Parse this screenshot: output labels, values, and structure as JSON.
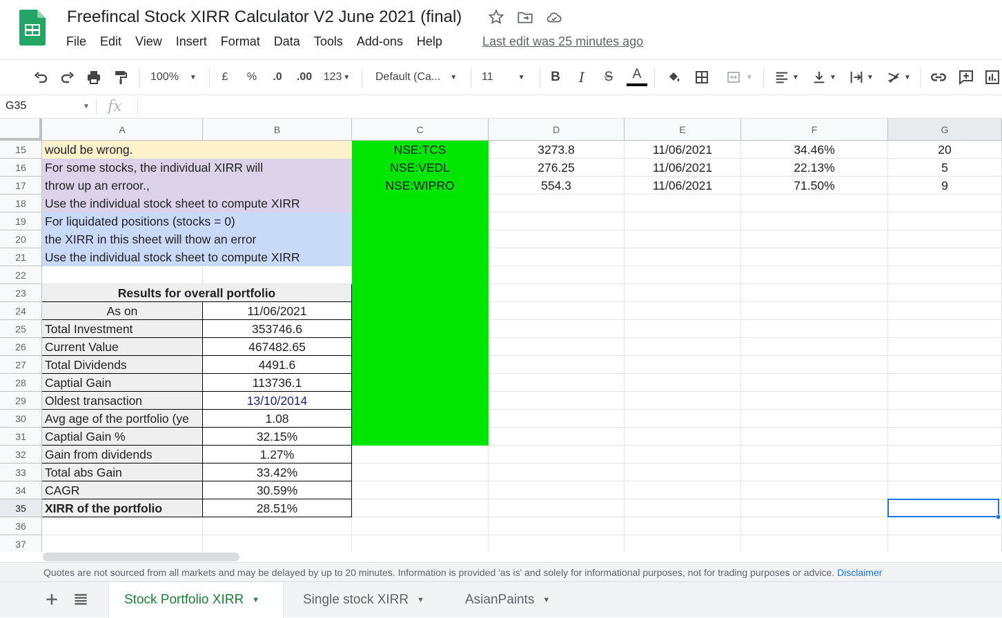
{
  "app": {
    "title": "Freefincal Stock XIRR Calculator V2 June 2021 (final)",
    "menus": [
      "File",
      "Edit",
      "View",
      "Insert",
      "Format",
      "Data",
      "Tools",
      "Add-ons",
      "Help"
    ],
    "last_edit": "Last edit was 25 minutes ago"
  },
  "toolbar": {
    "zoom": "100%",
    "currency": "£",
    "percent": "%",
    "decrease_decimal": ".0",
    "increase_decimal": ".00",
    "more_formats": "123",
    "font": "Default (Ca...",
    "font_size": "11",
    "bold": "B",
    "italic": "I",
    "strike": "S",
    "text_color": "A"
  },
  "formula_bar": {
    "cell_ref": "G35",
    "fx": "fx",
    "formula": ""
  },
  "columns": [
    "A",
    "B",
    "C",
    "D",
    "E",
    "F",
    "G"
  ],
  "rows": [
    {
      "n": "15",
      "a": "would be wrong.",
      "b": "",
      "c": "NSE:TCS",
      "d": "3273.8",
      "e": "11/06/2021",
      "f": "34.46%",
      "g": "20"
    },
    {
      "n": "16",
      "a": "For some stocks, the individual XIRR will",
      "b": "",
      "c": "NSE:VEDL",
      "d": "276.25",
      "e": "11/06/2021",
      "f": "22.13%",
      "g": "5"
    },
    {
      "n": "17",
      "a": "throw up an erroor.,",
      "b": "",
      "c": "NSE:WIPRO",
      "d": "554.3",
      "e": "11/06/2021",
      "f": "71.50%",
      "g": "9"
    },
    {
      "n": "18",
      "a": "Use the individual stock sheet to compute XIRR",
      "b": "",
      "c": "",
      "d": "",
      "e": "",
      "f": "",
      "g": ""
    },
    {
      "n": "19",
      "a": "For liquidated positions (stocks = 0)",
      "b": "",
      "c": "",
      "d": "",
      "e": "",
      "f": "",
      "g": ""
    },
    {
      "n": "20",
      "a": "the XIRR in this sheet will thow an error",
      "b": "",
      "c": "",
      "d": "",
      "e": "",
      "f": "",
      "g": ""
    },
    {
      "n": "21",
      "a": "Use the individual stock sheet to compute XIRR",
      "b": "",
      "c": "",
      "d": "",
      "e": "",
      "f": "",
      "g": ""
    },
    {
      "n": "22",
      "a": "",
      "b": "",
      "c": "",
      "d": "",
      "e": "",
      "f": "",
      "g": ""
    },
    {
      "n": "23",
      "a": "Results for overall portfolio",
      "b": "",
      "c": "",
      "d": "",
      "e": "",
      "f": "",
      "g": ""
    },
    {
      "n": "24",
      "a": "As on",
      "b": "11/06/2021",
      "c": "",
      "d": "",
      "e": "",
      "f": "",
      "g": ""
    },
    {
      "n": "25",
      "a": "Total Investment",
      "b": "353746.6",
      "c": "",
      "d": "",
      "e": "",
      "f": "",
      "g": ""
    },
    {
      "n": "26",
      "a": "Current Value",
      "b": "467482.65",
      "c": "",
      "d": "",
      "e": "",
      "f": "",
      "g": ""
    },
    {
      "n": "27",
      "a": "Total Dividends",
      "b": "4491.6",
      "c": "",
      "d": "",
      "e": "",
      "f": "",
      "g": ""
    },
    {
      "n": "28",
      "a": "Captial Gain",
      "b": "113736.1",
      "c": "",
      "d": "",
      "e": "",
      "f": "",
      "g": ""
    },
    {
      "n": "29",
      "a": "Oldest transaction",
      "b": "13/10/2014",
      "c": "",
      "d": "",
      "e": "",
      "f": "",
      "g": ""
    },
    {
      "n": "30",
      "a": "Avg age of the portfolio (ye",
      "b": "1.08",
      "c": "",
      "d": "",
      "e": "",
      "f": "",
      "g": ""
    },
    {
      "n": "31",
      "a": "Captial Gain %",
      "b": "32.15%",
      "c": "",
      "d": "",
      "e": "",
      "f": "",
      "g": ""
    },
    {
      "n": "32",
      "a": "Gain from dividends",
      "b": "1.27%",
      "c": "",
      "d": "",
      "e": "",
      "f": "",
      "g": ""
    },
    {
      "n": "33",
      "a": "Total abs Gain",
      "b": "33.42%",
      "c": "",
      "d": "",
      "e": "",
      "f": "",
      "g": ""
    },
    {
      "n": "34",
      "a": "CAGR",
      "b": "30.59%",
      "c": "",
      "d": "",
      "e": "",
      "f": "",
      "g": ""
    },
    {
      "n": "35",
      "a": "XIRR of the portfolio",
      "b": "28.51%",
      "c": "",
      "d": "",
      "e": "",
      "f": "",
      "g": ""
    },
    {
      "n": "36",
      "a": "",
      "b": "",
      "c": "",
      "d": "",
      "e": "",
      "f": "",
      "g": ""
    },
    {
      "n": "37",
      "a": "",
      "b": "",
      "c": "",
      "d": "",
      "e": "",
      "f": "",
      "g": ""
    }
  ],
  "disclaimer": {
    "text": "Quotes are not sourced from all markets and may be delayed by up to 20 minutes. Information is provided 'as is' and solely for informational purposes, not for trading purposes or advice.",
    "link": "Disclaimer"
  },
  "sheets": [
    {
      "label": "Stock Portfolio XIRR",
      "active": true
    },
    {
      "label": "Single stock XIRR",
      "active": false
    },
    {
      "label": "AsianPaints",
      "active": false
    }
  ],
  "colors": {
    "green_fill": "#00e600",
    "yellow_fill": "#fdf2cc",
    "purple_fill": "#dcd3ea",
    "blue_fill": "#c9daf8",
    "gray_fill": "#efefef",
    "active_tab": "#188038",
    "selection": "#1a73e8"
  }
}
